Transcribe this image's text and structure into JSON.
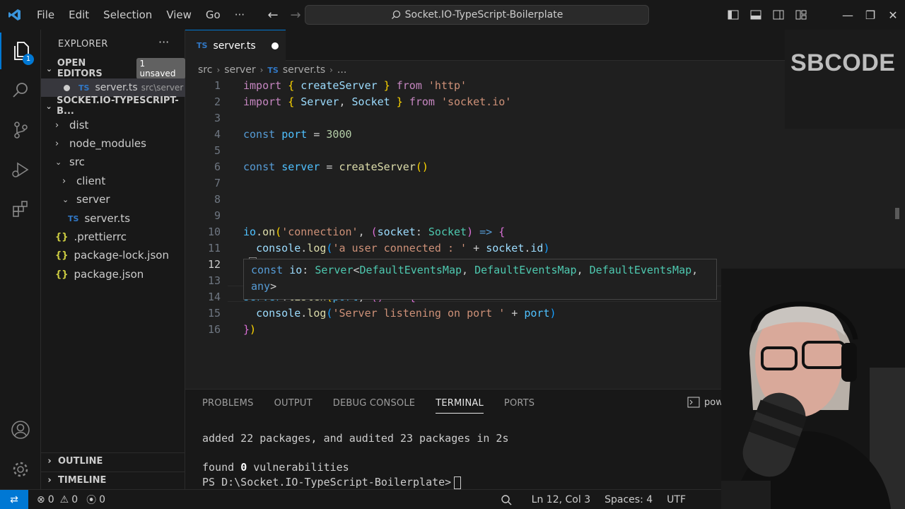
{
  "titlebar": {
    "menu": [
      "File",
      "Edit",
      "Selection",
      "View",
      "Go",
      "···"
    ],
    "command_center": "Socket.IO-TypeScript-Boilerplate"
  },
  "activity": {
    "explorer_badge": "1"
  },
  "sidebar": {
    "title": "EXPLORER",
    "open_editors_label": "OPEN EDITORS",
    "unsaved_badge": "1 unsaved",
    "open_editor": {
      "tag": "TS",
      "name": "server.ts",
      "path": "src\\server"
    },
    "project_label": "SOCKET.IO-TYPESCRIPT-B...",
    "tree": [
      {
        "name": "dist",
        "kind": "folder",
        "open": false
      },
      {
        "name": "node_modules",
        "kind": "folder",
        "open": false
      },
      {
        "name": "src",
        "kind": "folder",
        "open": true
      },
      {
        "name": "client",
        "kind": "folder",
        "open": false
      },
      {
        "name": "server",
        "kind": "folder",
        "open": true
      },
      {
        "name": "server.ts",
        "kind": "ts"
      },
      {
        "name": ".prettierrc",
        "kind": "json"
      },
      {
        "name": "package-lock.json",
        "kind": "json"
      },
      {
        "name": "package.json",
        "kind": "json"
      }
    ],
    "outline_label": "OUTLINE",
    "timeline_label": "TIMELINE"
  },
  "editor": {
    "tab": {
      "tag": "TS",
      "name": "server.ts",
      "dirty": true
    },
    "breadcrumb": [
      "src",
      "server",
      "server.ts",
      "..."
    ],
    "lines": [
      "1",
      "2",
      "3",
      "4",
      "5",
      "6",
      "7",
      "8",
      "9",
      "10",
      "11",
      "12",
      "13",
      "14",
      "15",
      "16"
    ],
    "current_line": "12",
    "hover": {
      "line1": "const io: Server<DefaultEventsMap, DefaultEventsMap, DefaultEventsMap,",
      "line2": "any>"
    }
  },
  "panel": {
    "tabs": [
      "PROBLEMS",
      "OUTPUT",
      "DEBUG CONSOLE",
      "TERMINAL",
      "PORTS"
    ],
    "active_tab": "TERMINAL",
    "shell": "powershell",
    "terminal": {
      "line1": "added 22 packages, and audited 23 packages in 2s",
      "line2_prefix": "found ",
      "line2_count": "0",
      "line2_suffix": " vulnerabilities",
      "prompt": "PS D:\\Socket.IO-TypeScript-Boilerplate>"
    }
  },
  "statusbar": {
    "errors": "0",
    "warnings": "0",
    "ports": "0",
    "position": "Ln 12, Col 3",
    "spaces": "Spaces: 4",
    "encoding": "UTF"
  },
  "overlay": {
    "brand": "SBCODE"
  },
  "colors": {
    "accent": "#0078d4",
    "ts": "#3178c6",
    "json": "#cbcb41"
  }
}
